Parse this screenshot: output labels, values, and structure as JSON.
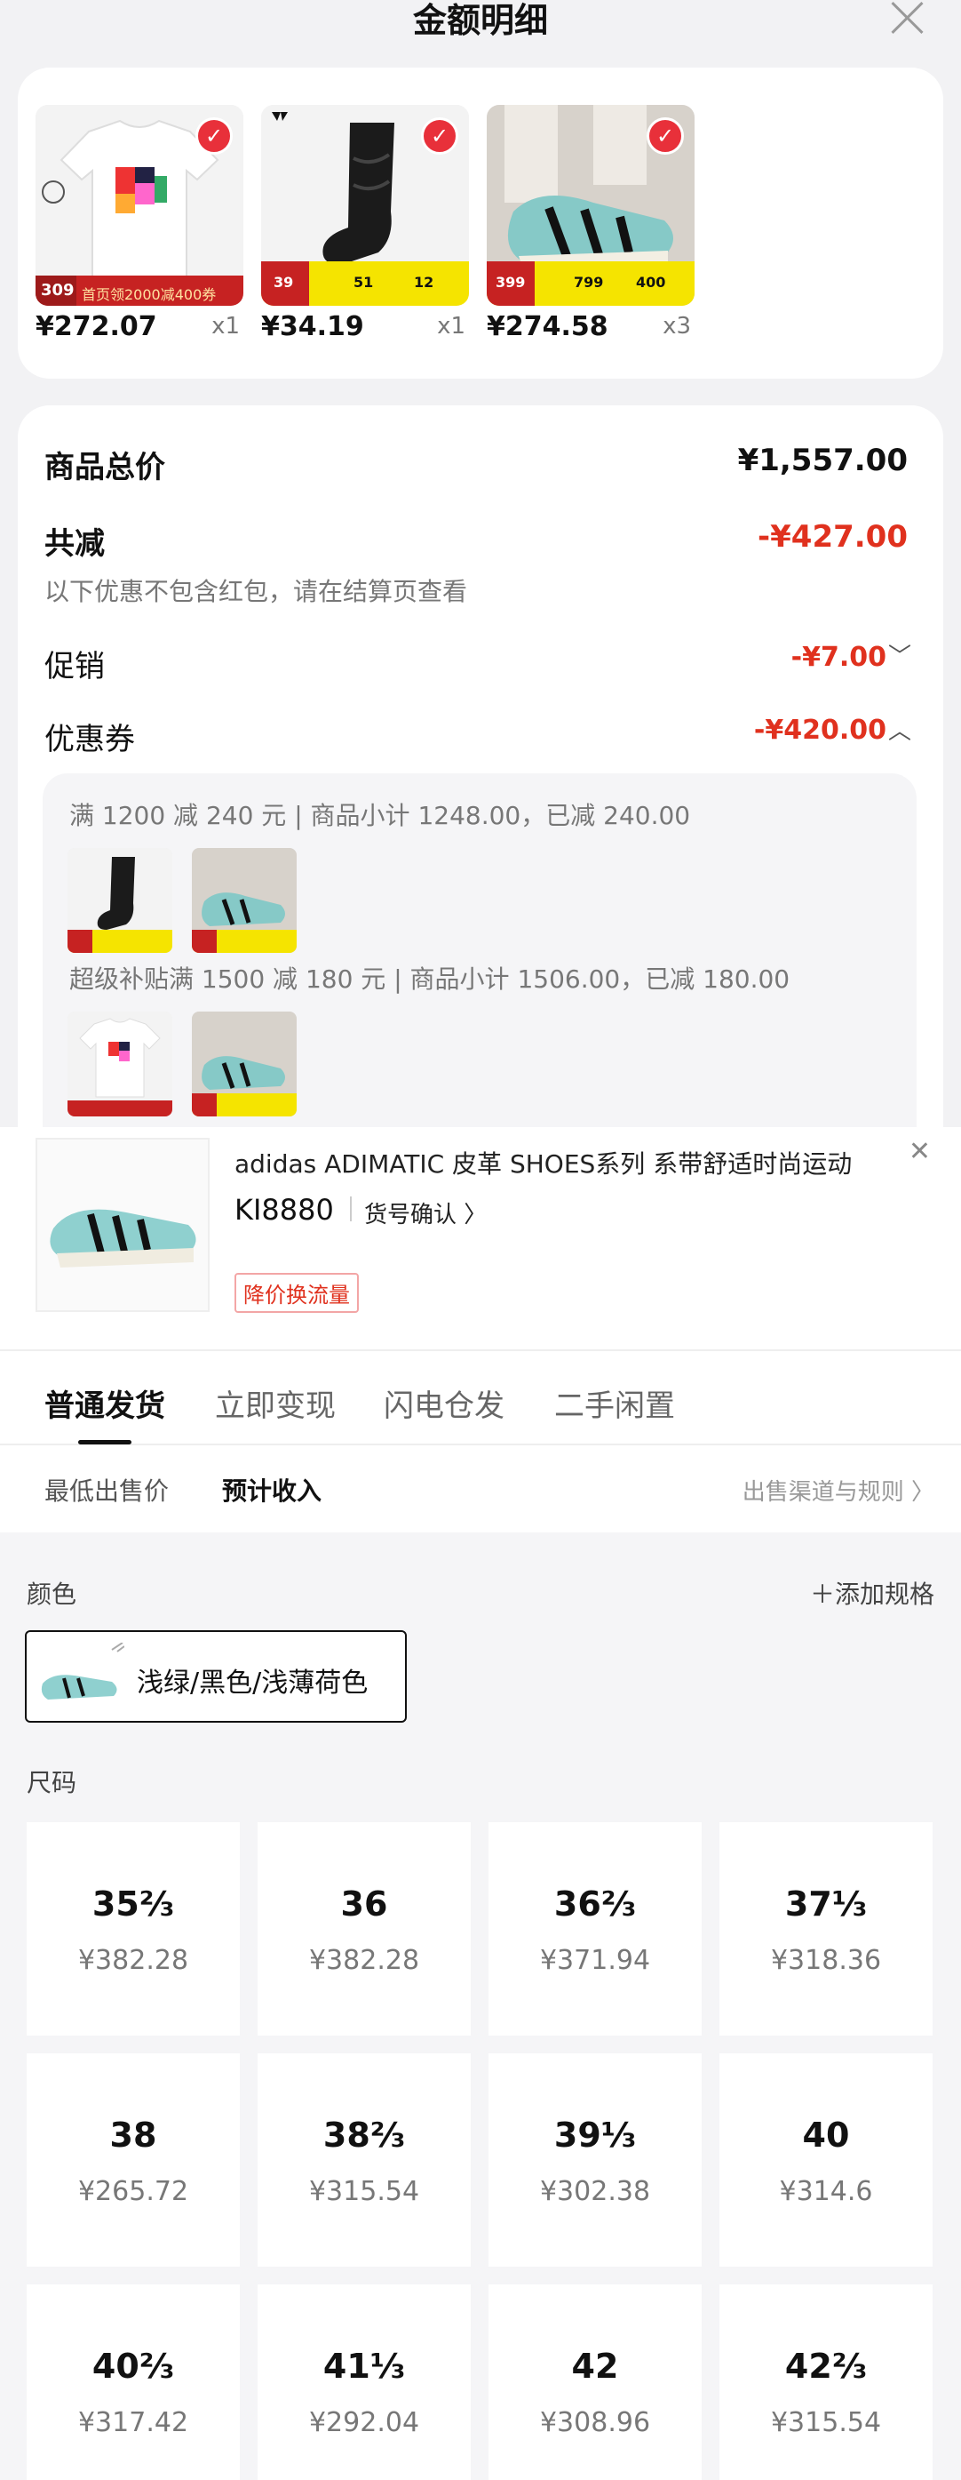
{
  "sheet": {
    "title": "金额明细",
    "products": [
      {
        "price": "¥272.07",
        "qty": "x1",
        "img": "tshirt",
        "banner": "首页领2000减400券",
        "banner_price": "309"
      },
      {
        "price": "¥34.19",
        "qty": "x1",
        "img": "sock"
      },
      {
        "price": "¥274.58",
        "qty": "x3",
        "img": "shoe"
      }
    ],
    "total_label": "商品总价",
    "total_value": "¥1,557.00",
    "reduce_label": "共减",
    "reduce_value": "-¥427.00",
    "reduce_note": "以下优惠不包含红包，请在结算页查看",
    "promo_label": "促销",
    "promo_value": "-¥7.00",
    "coupon_label": "优惠券",
    "coupon_value": "-¥420.00",
    "coupon_lines": [
      "满 1200 减 240 元 | 商品小计 1248.00，已减 240.00",
      "超级补贴满 1500 减 180 元 | 商品小计 1506.00，已减 180.00"
    ],
    "sock_prices": [
      "39",
      "51",
      "12"
    ],
    "shoe_prices": [
      "399",
      "799",
      "400"
    ]
  },
  "product": {
    "title": "adidas ADIMATIC 皮革 SHOES系列 系带舒适时尚运动",
    "code": "KI8880",
    "confirm": "货号确认 〉",
    "tag": "降价换流量",
    "close": "✕"
  },
  "tabs": [
    "普通发货",
    "立即变现",
    "闪电仓发",
    "二手闲置"
  ],
  "subtabs": {
    "left": "最低出售价",
    "right_active": "预计收入",
    "rules": "出售渠道与规则 〉"
  },
  "spec": {
    "color_label": "颜色",
    "add_spec": "＋添加规格",
    "color_name": "浅绿/黑色/浅薄荷色",
    "size_label": "尺码",
    "sizes": [
      {
        "size": "35⅔",
        "price": "¥382.28"
      },
      {
        "size": "36",
        "price": "¥382.28"
      },
      {
        "size": "36⅔",
        "price": "¥371.94"
      },
      {
        "size": "37⅓",
        "price": "¥318.36"
      },
      {
        "size": "38",
        "price": "¥265.72"
      },
      {
        "size": "38⅔",
        "price": "¥315.54"
      },
      {
        "size": "39⅓",
        "price": "¥302.38"
      },
      {
        "size": "40",
        "price": "¥314.6"
      },
      {
        "size": "40⅔",
        "price": "¥317.42"
      },
      {
        "size": "41⅓",
        "price": "¥292.04"
      },
      {
        "size": "42",
        "price": "¥308.96"
      },
      {
        "size": "42⅔",
        "price": "¥315.54"
      }
    ]
  },
  "colors": {
    "accent_red": "#e0311e",
    "check_red": "#e8303a",
    "mint": "#8fd0cf"
  }
}
